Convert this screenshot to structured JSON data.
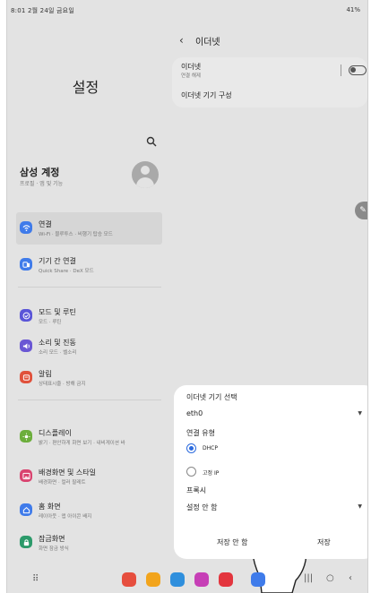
{
  "status_bar": {
    "left": "8:01  2월 24일 금요일",
    "right": "41%"
  },
  "left_pane": {
    "title": "설정",
    "account": {
      "name": "삼성 계정",
      "sub": "프로필 · 앱 및 기능"
    },
    "items": [
      {
        "label": "연결",
        "sub": "Wi-Fi · 블루투스 · 비행기 탑승 모드",
        "icon": "wifi-icon",
        "color": "#3f7bea"
      },
      {
        "label": "기기 간 연결",
        "sub": "Quick Share · DeX 모드",
        "icon": "devices-icon",
        "color": "#3f7bea"
      },
      {
        "label": "모드 및 루틴",
        "sub": "모드 · 루틴",
        "icon": "check-icon",
        "color": "#5a55d8"
      },
      {
        "label": "소리 및 진동",
        "sub": "소리 모드 · 벨소리",
        "icon": "volume-icon",
        "color": "#6a57d4"
      },
      {
        "label": "알림",
        "sub": "상태표시줄 · 방해 금지",
        "icon": "bell-icon",
        "color": "#e0513b"
      },
      {
        "label": "디스플레이",
        "sub": "밝기 · 편안하게 화면 보기 · 내비게이션 바",
        "icon": "sun-icon",
        "color": "#6cae3c"
      },
      {
        "label": "배경화면 및 스타일",
        "sub": "배경화면 · 컬러 팔레트",
        "icon": "image-icon",
        "color": "#d9436f"
      },
      {
        "label": "홈 화면",
        "sub": "레이아웃 · 앱 아이콘 배지",
        "icon": "home-icon",
        "color": "#3f7bea"
      },
      {
        "label": "잠금화면",
        "sub": "화면 잠금 방식",
        "icon": "lock-icon",
        "color": "#2c9a6a"
      }
    ]
  },
  "right_pane": {
    "title": "이더넷",
    "ethernet_row": {
      "title": "이더넷",
      "sub": "연결 해제"
    },
    "config_row": {
      "title": "이더넷 기기 구성"
    }
  },
  "dialog": {
    "title": "이더넷 기기 선택",
    "device_value": "eth0",
    "conn_type_label": "연결 유형",
    "options": [
      "DHCP",
      "고정 IP"
    ],
    "selected_option": "DHCP",
    "proxy_label": "프록시",
    "proxy_value": "설정 안 함",
    "cancel_label": "저장 안 함",
    "save_label": "저장"
  },
  "dock": {
    "apps": [
      {
        "icon": "app-icon-1",
        "color": "#e64e3e"
      },
      {
        "icon": "app-icon-2",
        "color": "#f2a41c"
      },
      {
        "icon": "app-icon-3",
        "color": "#2f8fdd"
      },
      {
        "icon": "app-icon-4",
        "color": "#c63fb6"
      },
      {
        "icon": "app-icon-5",
        "color": "#e3353e"
      },
      {
        "icon": "app-icon-6",
        "color": "#3f7bea"
      }
    ]
  }
}
